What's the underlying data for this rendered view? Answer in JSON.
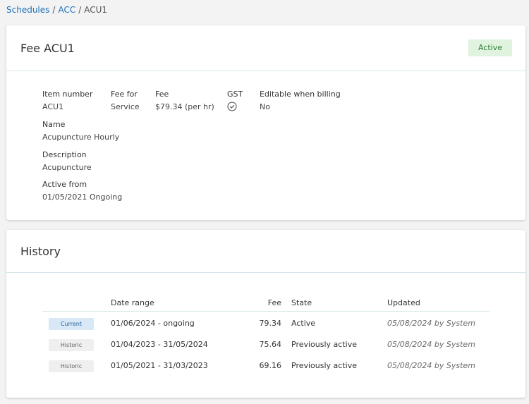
{
  "breadcrumb": {
    "items": [
      "Schedules",
      "ACC"
    ],
    "current": "ACU1",
    "separator": "/"
  },
  "fee_card": {
    "title": "Fee ACU1",
    "status": "Active",
    "fields": {
      "item_number": {
        "label": "Item number",
        "value": "ACU1"
      },
      "fee_for": {
        "label": "Fee for",
        "value": "Service"
      },
      "fee": {
        "label": "Fee",
        "value": "$79.34 (per hr)"
      },
      "gst": {
        "label": "GST",
        "icon": "check-circle-icon"
      },
      "editable": {
        "label": "Editable when billing",
        "value": "No"
      },
      "name": {
        "label": "Name",
        "value": "Acupuncture Hourly"
      },
      "description": {
        "label": "Description",
        "value": "Acupuncture"
      },
      "active_from": {
        "label": "Active from",
        "value": "01/05/2021 Ongoing"
      }
    }
  },
  "history": {
    "title": "History",
    "headers": {
      "date_range": "Date range",
      "fee": "Fee",
      "state": "State",
      "updated": "Updated"
    },
    "rows": [
      {
        "badge": "Current",
        "date_range": "01/06/2024 - ongoing",
        "fee": "79.34",
        "state": "Active",
        "updated": "05/08/2024 by System"
      },
      {
        "badge": "Historic",
        "date_range": "01/04/2023 - 31/05/2024",
        "fee": "75.64",
        "state": "Previously active",
        "updated": "05/08/2024 by System"
      },
      {
        "badge": "Historic",
        "date_range": "01/05/2021 - 31/03/2023",
        "fee": "69.16",
        "state": "Previously active",
        "updated": "05/08/2024 by System"
      }
    ]
  },
  "colors": {
    "link": "#1f6fb5",
    "active_bg": "#dff3df",
    "active_text": "#2d7a34",
    "divider": "#d5e7ea",
    "current_badge_bg": "#d8e8f6",
    "historic_badge_bg": "#efefef"
  }
}
